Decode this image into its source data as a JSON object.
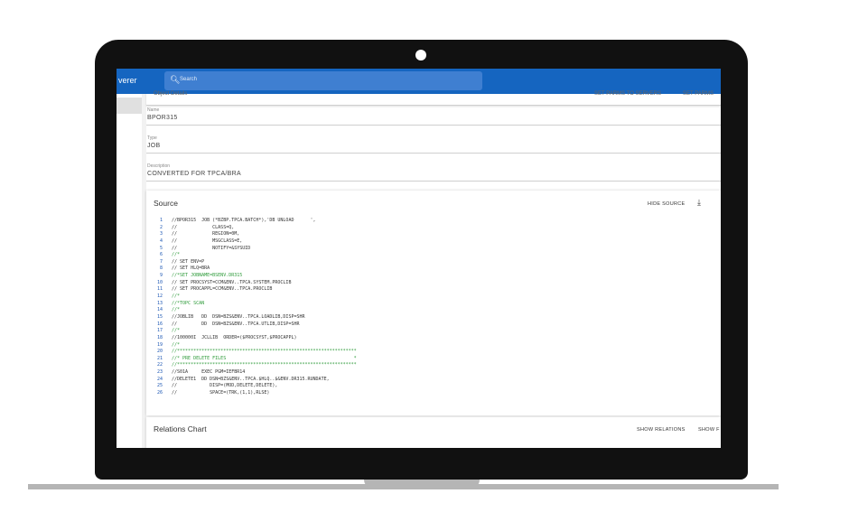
{
  "app": {
    "title_fragment": "verer"
  },
  "search": {
    "placeholder": "Search"
  },
  "clipped_header": {
    "left": "Object Details",
    "right1": "SET PARMS TO SERVERS",
    "right2": "SET PARMS"
  },
  "fields": [
    {
      "label": "Name",
      "value": "BPOR315"
    },
    {
      "label": "Type",
      "value": "JOB"
    },
    {
      "label": "Description",
      "value": "CONVERTED FOR TPCA/BRA"
    }
  ],
  "source": {
    "title": "Source",
    "hide_label": "HIDE SOURCE",
    "lines": [
      {
        "n": "1",
        "text": "//BPOR315  JOB (*BZBP.TPCA.BATCH*),'DB UNLOAD      ',",
        "comment": false
      },
      {
        "n": "2",
        "text": "//             CLASS=Q,",
        "comment": false
      },
      {
        "n": "3",
        "text": "//             REGION=0M,",
        "comment": false
      },
      {
        "n": "4",
        "text": "//             MSGCLASS=E,",
        "comment": false
      },
      {
        "n": "5",
        "text": "//             NOTIFY=&SYSUID",
        "comment": false
      },
      {
        "n": "6",
        "text": "//*",
        "comment": true
      },
      {
        "n": "7",
        "text": "// SET ENV=P",
        "comment": false
      },
      {
        "n": "8",
        "text": "// SET HLQ=BRA",
        "comment": false
      },
      {
        "n": "9",
        "text": "//*SET JOBNAME=BSENV.DR315",
        "comment": true
      },
      {
        "n": "10",
        "text": "// SET PROCSYST=CCM&ENV..TPCA.SYSTEM.PROCLIB",
        "comment": false
      },
      {
        "n": "11",
        "text": "// SET PROCAPPL=CCM&ENV..TPCA.PROCLIB",
        "comment": false
      },
      {
        "n": "12",
        "text": "//*",
        "comment": true
      },
      {
        "n": "13",
        "text": "//*TOPC SCAN",
        "comment": true
      },
      {
        "n": "14",
        "text": "//*",
        "comment": true
      },
      {
        "n": "15",
        "text": "//JOBLIB   DD  DSN=BZS&ENV..TPCA.LOADLIB,DISP=SHR",
        "comment": false
      },
      {
        "n": "16",
        "text": "//         DD  DSN=BZS&ENV..TPCA.UTLIB,DISP=SHR",
        "comment": false
      },
      {
        "n": "17",
        "text": "//*",
        "comment": true
      },
      {
        "n": "18",
        "text": "//100000I  JCLLIB  ORDER=($PROCSYST,$PROCAPPL)",
        "comment": false
      },
      {
        "n": "19",
        "text": "//*",
        "comment": true
      },
      {
        "n": "20",
        "text": "//******************************************************************",
        "comment": true
      },
      {
        "n": "21",
        "text": "//* PRE DELETE FILES                                               *",
        "comment": true
      },
      {
        "n": "22",
        "text": "//******************************************************************",
        "comment": true
      },
      {
        "n": "23",
        "text": "//S01A     EXEC PGM=IEFBR14",
        "comment": false
      },
      {
        "n": "24",
        "text": "//DELETE1  DD DSN=BZS&ENV..TPCA.$HLQ..$&ENV.DR315.RUNDATE,",
        "comment": false
      },
      {
        "n": "25",
        "text": "//            DISP=(MOD,DELETE,DELETE),",
        "comment": false
      },
      {
        "n": "26",
        "text": "//            SPACE=(TRK,(1,1),RLSE)",
        "comment": false
      }
    ]
  },
  "relations": {
    "title": "Relations Chart",
    "show_relations_label": "SHOW RELATIONS",
    "show_other_label": "SHOW F"
  }
}
